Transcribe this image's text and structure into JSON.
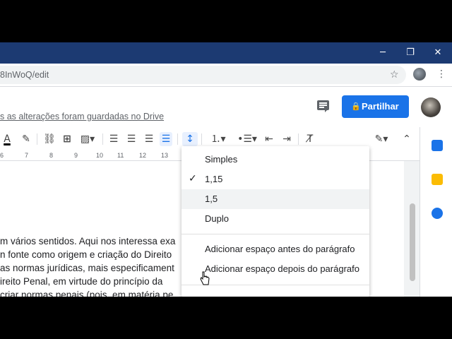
{
  "browser": {
    "url_fragment": "8InWoQ/edit",
    "window_controls": {
      "minimize": "─",
      "restore": "❐",
      "close": "✕"
    }
  },
  "doc": {
    "save_status": "s as alterações foram guardadas no Drive",
    "share_label": "Partilhar"
  },
  "ruler": {
    "ticks": [
      "6",
      "7",
      "8",
      "9",
      "10",
      "11",
      "12",
      "13"
    ]
  },
  "body_lines": [
    "m vários sentidos. Aqui nos interessa exa",
    "n fonte como origem e criação do Direito",
    "as normas jurídicas, mais especificament",
    "ireito Penal, em virtude do princípio da",
    " criar normas penais (pois, em matéria pe"
  ],
  "line_spacing_menu": {
    "options": [
      {
        "label": "Simples",
        "checked": false
      },
      {
        "label": "1,15",
        "checked": true
      },
      {
        "label": "1,5",
        "checked": false,
        "hovered": true
      },
      {
        "label": "Duplo",
        "checked": false
      }
    ],
    "extra_options": [
      "Adicionar espaço antes do parágrafo",
      "Adicionar espaço depois do parágrafo"
    ]
  },
  "colors": {
    "titlebar": "#1c3a72",
    "share": "#1a73e8",
    "hover": "#f1f3f4"
  }
}
